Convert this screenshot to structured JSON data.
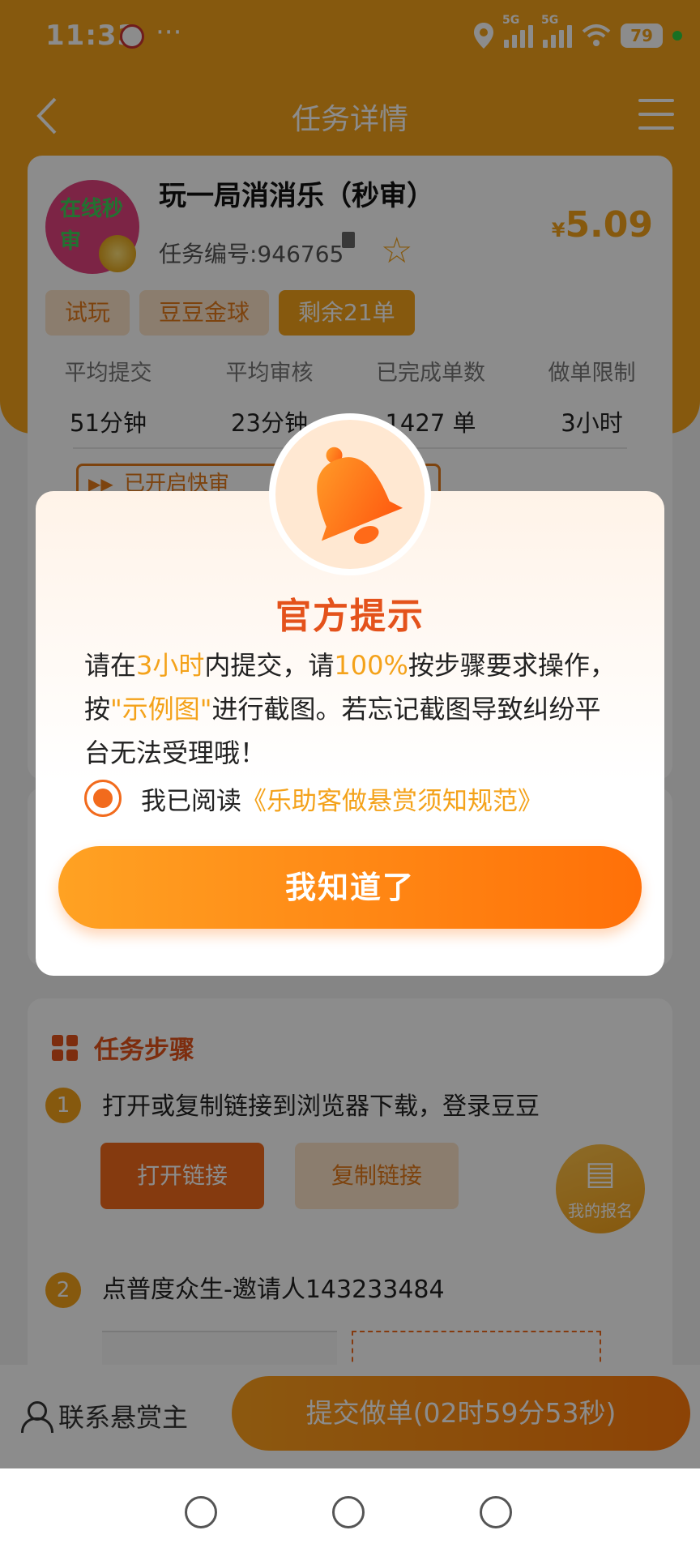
{
  "status_bar": {
    "time": "11:33",
    "dots": "···",
    "net1": "5G",
    "net2": "5G",
    "battery": "79"
  },
  "nav": {
    "title": "任务详情"
  },
  "task": {
    "avatar_text": "在线秒审",
    "title": "玩一局消消乐（秒审）",
    "number": "任务编号:946765",
    "price_currency": "¥",
    "price": "5.09",
    "tags": [
      "试玩",
      "豆豆金球",
      "剩余21单"
    ],
    "stats": [
      {
        "label": "平均提交",
        "value": "51分钟"
      },
      {
        "label": "平均审核",
        "value": "23分钟"
      },
      {
        "label": "已完成单数",
        "value": "1427 单"
      },
      {
        "label": "做单限制",
        "value": "3小时"
      }
    ],
    "fast_review": "已开启快审"
  },
  "steps": {
    "title": "任务步骤",
    "items": [
      {
        "num": "1",
        "text": "打开或复制链接到浏览器下载，登录豆豆"
      },
      {
        "num": "2",
        "text": "点普度众生-邀请人143233484"
      }
    ],
    "open_link": "打开链接",
    "copy_link": "复制链接",
    "my_signup": "我的报名"
  },
  "action_bar": {
    "contact": "联系悬赏主",
    "submit": "提交做单(02时59分53秒)"
  },
  "modal": {
    "title": "官方提示",
    "body": {
      "p1": "请在",
      "h1": "3小时",
      "p2": "内提交，请",
      "h2": "100%",
      "p3": "按步骤要求操作，按",
      "h3": "\"示例图\"",
      "p4": "进行截图。若忘记截图导致纠纷平台无法受理哦！"
    },
    "agree_text": "我已阅读",
    "agree_link": "《乐助客做悬赏须知规范》",
    "confirm": "我知道了"
  },
  "colors": {
    "brand_orange": "#f4a21a",
    "accent_red": "#e4521b"
  }
}
